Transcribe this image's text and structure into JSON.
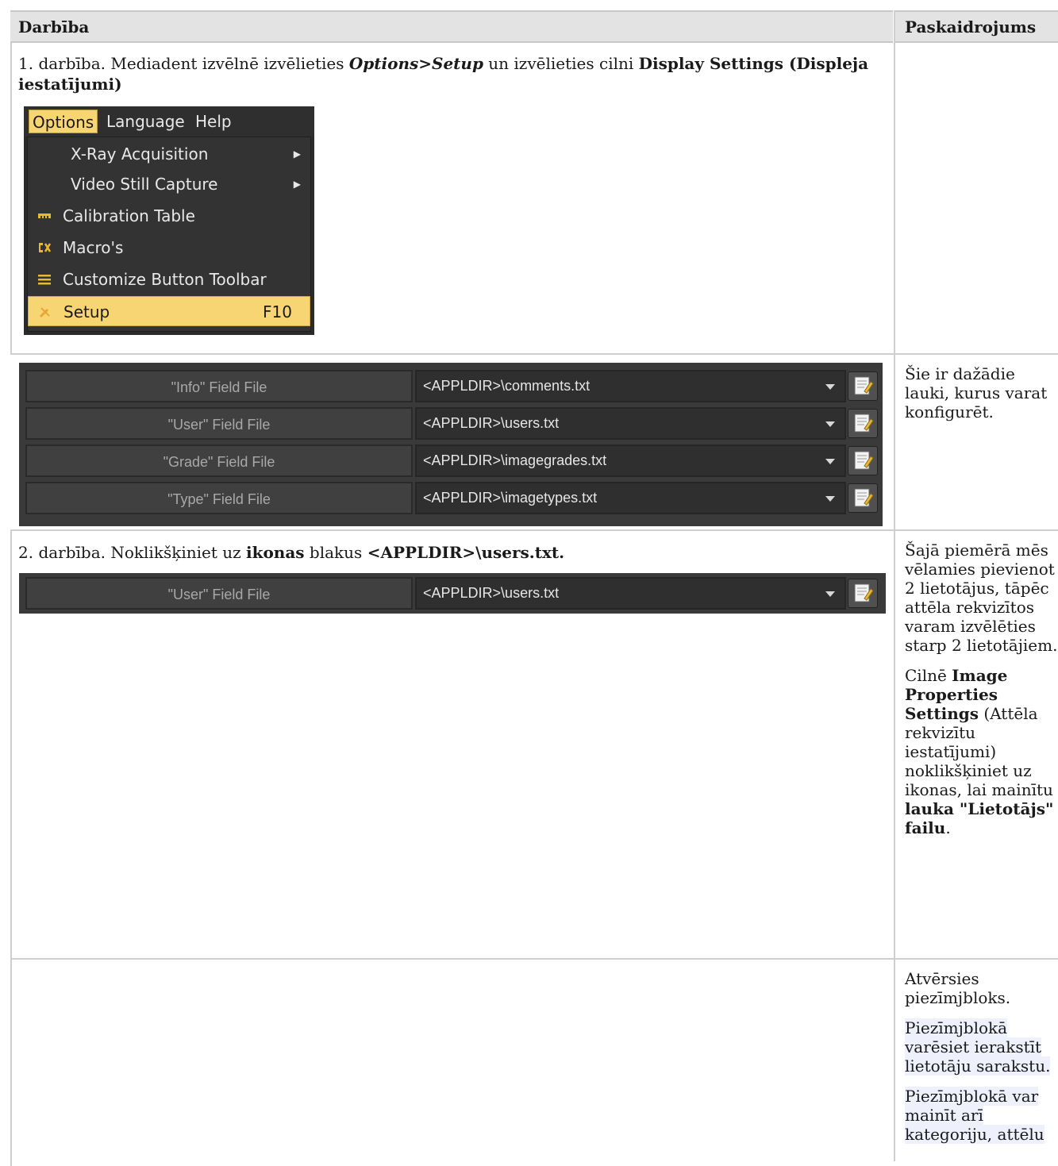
{
  "header": {
    "col1": "Darbība",
    "col2": "Paskaidrojums"
  },
  "row1": {
    "text_prefix": "1. darbība. Mediadent izvēlnē izvēlieties ",
    "text_menu": "Options>Setup",
    "text_mid": " un izvēlieties cilni ",
    "text_tab": "Display Settings (Displeja iestatījumi)",
    "menu": {
      "bar": [
        "Options",
        "Language",
        "Help"
      ],
      "items": [
        {
          "label": "X-Ray Acquisition",
          "icon": "none",
          "submenu": true
        },
        {
          "label": "Video Still Capture",
          "icon": "none",
          "submenu": true
        },
        {
          "label": "Calibration Table",
          "icon": "ruler-icon",
          "submenu": false
        },
        {
          "label": "Macro's",
          "icon": "macro-icon",
          "submenu": false
        },
        {
          "label": "Customize Button Toolbar",
          "icon": "toolbar-icon",
          "submenu": false
        },
        {
          "label": "Setup",
          "icon": "wrench-icon",
          "shortcut": "F10",
          "selected": true
        }
      ]
    }
  },
  "row2": {
    "fields": [
      {
        "label": "\"Info\" Field File",
        "value": "<APPLDIR>\\comments.txt"
      },
      {
        "label": "\"User\" Field File",
        "value": "<APPLDIR>\\users.txt"
      },
      {
        "label": "\"Grade\" Field File",
        "value": "<APPLDIR>\\imagegrades.txt"
      },
      {
        "label": "\"Type\" Field File",
        "value": "<APPLDIR>\\imagetypes.txt"
      }
    ],
    "note": "Šie ir dažādie lauki, kurus varat konfigurēt."
  },
  "row3": {
    "text_prefix": "2. darbība. Noklikšķiniet uz ",
    "text_bold1": "ikonas",
    "text_mid": " blakus ",
    "text_bold2": "<APPLDIR>\\users.txt.",
    "field": {
      "label": "\"User\" Field File",
      "value": "<APPLDIR>\\users.txt"
    },
    "note_p1": "Šajā piemērā mēs vēlamies pievienot 2 lietotājus, tāpēc attēla rekvizītos varam izvēlēties starp 2 lietotājiem.",
    "note_p2_a": "Cilnē ",
    "note_p2_b": "Image Properties Settings",
    "note_p2_c": " (Attēla rekvizītu iestatījumi) noklikšķiniet uz ikonas, lai mainītu ",
    "note_p2_d": "lauka \"Lietotājs\" failu",
    "note_p2_e": "."
  },
  "row4": {
    "note_p1": "Atvērsies piezīmjbloks.",
    "note_p2": "Piezīmjblokā varēsiet ierakstīt lietotāju sarakstu.",
    "note_p3": "Piezīmjblokā var mainīt arī kategoriju, attēlu"
  },
  "colors": {
    "header_bg": "#e3e3e3",
    "menu_highlight": "#f8d573",
    "panel_bg": "#3a3a3a"
  }
}
